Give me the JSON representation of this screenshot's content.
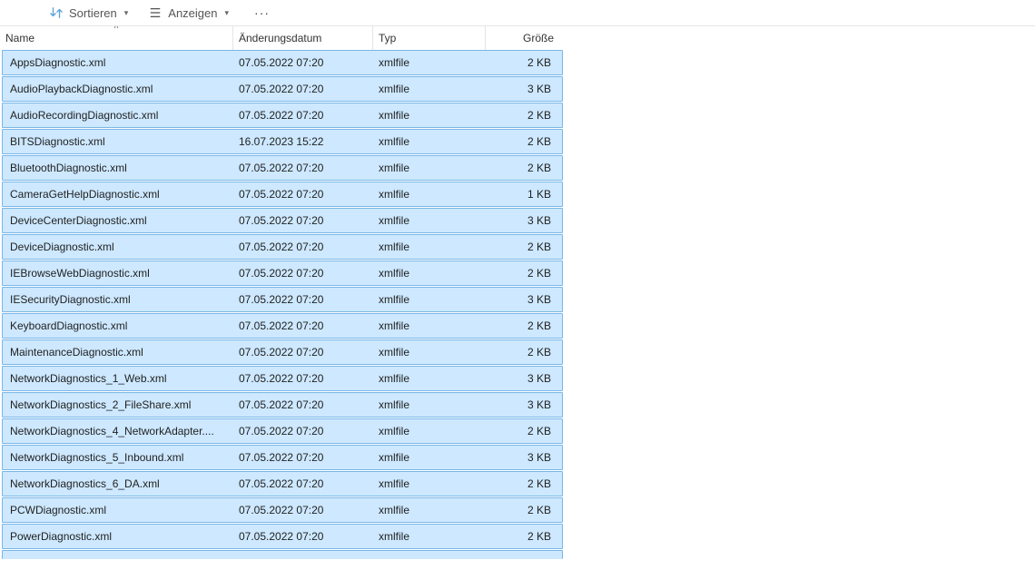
{
  "toolbar": {
    "sort_label": "Sortieren",
    "view_label": "Anzeigen"
  },
  "columns": {
    "name": "Name",
    "date": "Änderungsdatum",
    "type": "Typ",
    "size": "Größe"
  },
  "files": [
    {
      "name": "AppsDiagnostic.xml",
      "date": "07.05.2022 07:20",
      "type": "xmlfile",
      "size": "2 KB"
    },
    {
      "name": "AudioPlaybackDiagnostic.xml",
      "date": "07.05.2022 07:20",
      "type": "xmlfile",
      "size": "3 KB"
    },
    {
      "name": "AudioRecordingDiagnostic.xml",
      "date": "07.05.2022 07:20",
      "type": "xmlfile",
      "size": "2 KB"
    },
    {
      "name": "BITSDiagnostic.xml",
      "date": "16.07.2023 15:22",
      "type": "xmlfile",
      "size": "2 KB"
    },
    {
      "name": "BluetoothDiagnostic.xml",
      "date": "07.05.2022 07:20",
      "type": "xmlfile",
      "size": "2 KB"
    },
    {
      "name": "CameraGetHelpDiagnostic.xml",
      "date": "07.05.2022 07:20",
      "type": "xmlfile",
      "size": "1 KB"
    },
    {
      "name": "DeviceCenterDiagnostic.xml",
      "date": "07.05.2022 07:20",
      "type": "xmlfile",
      "size": "3 KB"
    },
    {
      "name": "DeviceDiagnostic.xml",
      "date": "07.05.2022 07:20",
      "type": "xmlfile",
      "size": "2 KB"
    },
    {
      "name": "IEBrowseWebDiagnostic.xml",
      "date": "07.05.2022 07:20",
      "type": "xmlfile",
      "size": "2 KB"
    },
    {
      "name": "IESecurityDiagnostic.xml",
      "date": "07.05.2022 07:20",
      "type": "xmlfile",
      "size": "3 KB"
    },
    {
      "name": "KeyboardDiagnostic.xml",
      "date": "07.05.2022 07:20",
      "type": "xmlfile",
      "size": "2 KB"
    },
    {
      "name": "MaintenanceDiagnostic.xml",
      "date": "07.05.2022 07:20",
      "type": "xmlfile",
      "size": "2 KB"
    },
    {
      "name": "NetworkDiagnostics_1_Web.xml",
      "date": "07.05.2022 07:20",
      "type": "xmlfile",
      "size": "3 KB"
    },
    {
      "name": "NetworkDiagnostics_2_FileShare.xml",
      "date": "07.05.2022 07:20",
      "type": "xmlfile",
      "size": "3 KB"
    },
    {
      "name": "NetworkDiagnostics_4_NetworkAdapter....",
      "date": "07.05.2022 07:20",
      "type": "xmlfile",
      "size": "2 KB"
    },
    {
      "name": "NetworkDiagnostics_5_Inbound.xml",
      "date": "07.05.2022 07:20",
      "type": "xmlfile",
      "size": "3 KB"
    },
    {
      "name": "NetworkDiagnostics_6_DA.xml",
      "date": "07.05.2022 07:20",
      "type": "xmlfile",
      "size": "2 KB"
    },
    {
      "name": "PCWDiagnostic.xml",
      "date": "07.05.2022 07:20",
      "type": "xmlfile",
      "size": "2 KB"
    },
    {
      "name": "PowerDiagnostic.xml",
      "date": "07.05.2022 07:20",
      "type": "xmlfile",
      "size": "2 KB"
    }
  ]
}
